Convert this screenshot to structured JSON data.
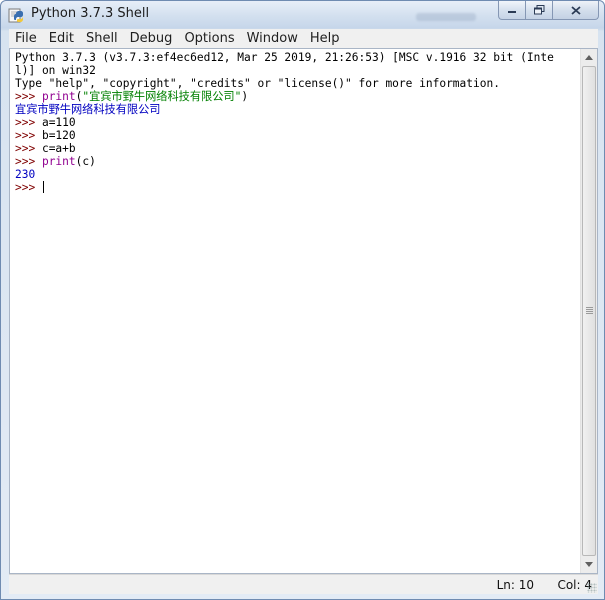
{
  "window": {
    "title": "Python 3.7.3 Shell",
    "icons": {
      "app": "python-idle-icon",
      "minimize": "minimize-icon",
      "maximize": "maximize-icon",
      "close": "close-icon"
    }
  },
  "menu": {
    "items": [
      "File",
      "Edit",
      "Shell",
      "Debug",
      "Options",
      "Window",
      "Help"
    ]
  },
  "shell": {
    "lines": [
      [
        {
          "t": "Python 3.7.3 (v3.7.3:ef4ec6ed12, Mar 25 2019, 21:26:53) [MSC v.1916 32 bit (Inte",
          "c": "plain"
        }
      ],
      [
        {
          "t": "l)] on win32",
          "c": "plain"
        }
      ],
      [
        {
          "t": "Type \"help\", \"copyright\", \"credits\" or \"license()\" for more information.",
          "c": "plain"
        }
      ],
      [
        {
          "t": ">>> ",
          "c": "prompt"
        },
        {
          "t": "print",
          "c": "kw"
        },
        {
          "t": "(",
          "c": "plain"
        },
        {
          "t": "\"宜宾市野牛网络科技有限公司\"",
          "c": "str"
        },
        {
          "t": ")",
          "c": "plain"
        }
      ],
      [
        {
          "t": "宜宾市野牛网络科技有限公司",
          "c": "out"
        }
      ],
      [
        {
          "t": ">>> ",
          "c": "prompt"
        },
        {
          "t": "a=110",
          "c": "plain"
        }
      ],
      [
        {
          "t": ">>> ",
          "c": "prompt"
        },
        {
          "t": "b=120",
          "c": "plain"
        }
      ],
      [
        {
          "t": ">>> ",
          "c": "prompt"
        },
        {
          "t": "c=a+b",
          "c": "plain"
        }
      ],
      [
        {
          "t": ">>> ",
          "c": "prompt"
        },
        {
          "t": "print",
          "c": "kw"
        },
        {
          "t": "(c)",
          "c": "plain"
        }
      ],
      [
        {
          "t": "230",
          "c": "out"
        }
      ],
      [
        {
          "t": ">>> ",
          "c": "prompt"
        }
      ]
    ]
  },
  "status": {
    "ln": "Ln: 10",
    "col": "Col: 4"
  },
  "colors": {
    "prompt": "#7f0000",
    "keyword": "#900090",
    "string": "#008000",
    "output": "#0000c0"
  }
}
